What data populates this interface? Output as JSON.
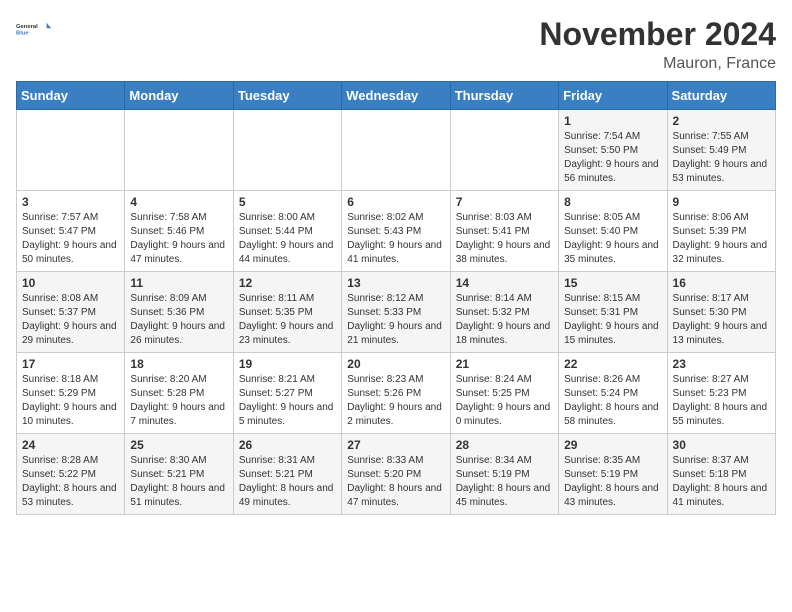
{
  "header": {
    "logo_general": "General",
    "logo_blue": "Blue",
    "title": "November 2024",
    "location": "Mauron, France"
  },
  "calendar": {
    "weekdays": [
      "Sunday",
      "Monday",
      "Tuesday",
      "Wednesday",
      "Thursday",
      "Friday",
      "Saturday"
    ],
    "weeks": [
      [
        {
          "day": "",
          "detail": ""
        },
        {
          "day": "",
          "detail": ""
        },
        {
          "day": "",
          "detail": ""
        },
        {
          "day": "",
          "detail": ""
        },
        {
          "day": "",
          "detail": ""
        },
        {
          "day": "1",
          "detail": "Sunrise: 7:54 AM\nSunset: 5:50 PM\nDaylight: 9 hours and 56 minutes."
        },
        {
          "day": "2",
          "detail": "Sunrise: 7:55 AM\nSunset: 5:49 PM\nDaylight: 9 hours and 53 minutes."
        }
      ],
      [
        {
          "day": "3",
          "detail": "Sunrise: 7:57 AM\nSunset: 5:47 PM\nDaylight: 9 hours and 50 minutes."
        },
        {
          "day": "4",
          "detail": "Sunrise: 7:58 AM\nSunset: 5:46 PM\nDaylight: 9 hours and 47 minutes."
        },
        {
          "day": "5",
          "detail": "Sunrise: 8:00 AM\nSunset: 5:44 PM\nDaylight: 9 hours and 44 minutes."
        },
        {
          "day": "6",
          "detail": "Sunrise: 8:02 AM\nSunset: 5:43 PM\nDaylight: 9 hours and 41 minutes."
        },
        {
          "day": "7",
          "detail": "Sunrise: 8:03 AM\nSunset: 5:41 PM\nDaylight: 9 hours and 38 minutes."
        },
        {
          "day": "8",
          "detail": "Sunrise: 8:05 AM\nSunset: 5:40 PM\nDaylight: 9 hours and 35 minutes."
        },
        {
          "day": "9",
          "detail": "Sunrise: 8:06 AM\nSunset: 5:39 PM\nDaylight: 9 hours and 32 minutes."
        }
      ],
      [
        {
          "day": "10",
          "detail": "Sunrise: 8:08 AM\nSunset: 5:37 PM\nDaylight: 9 hours and 29 minutes."
        },
        {
          "day": "11",
          "detail": "Sunrise: 8:09 AM\nSunset: 5:36 PM\nDaylight: 9 hours and 26 minutes."
        },
        {
          "day": "12",
          "detail": "Sunrise: 8:11 AM\nSunset: 5:35 PM\nDaylight: 9 hours and 23 minutes."
        },
        {
          "day": "13",
          "detail": "Sunrise: 8:12 AM\nSunset: 5:33 PM\nDaylight: 9 hours and 21 minutes."
        },
        {
          "day": "14",
          "detail": "Sunrise: 8:14 AM\nSunset: 5:32 PM\nDaylight: 9 hours and 18 minutes."
        },
        {
          "day": "15",
          "detail": "Sunrise: 8:15 AM\nSunset: 5:31 PM\nDaylight: 9 hours and 15 minutes."
        },
        {
          "day": "16",
          "detail": "Sunrise: 8:17 AM\nSunset: 5:30 PM\nDaylight: 9 hours and 13 minutes."
        }
      ],
      [
        {
          "day": "17",
          "detail": "Sunrise: 8:18 AM\nSunset: 5:29 PM\nDaylight: 9 hours and 10 minutes."
        },
        {
          "day": "18",
          "detail": "Sunrise: 8:20 AM\nSunset: 5:28 PM\nDaylight: 9 hours and 7 minutes."
        },
        {
          "day": "19",
          "detail": "Sunrise: 8:21 AM\nSunset: 5:27 PM\nDaylight: 9 hours and 5 minutes."
        },
        {
          "day": "20",
          "detail": "Sunrise: 8:23 AM\nSunset: 5:26 PM\nDaylight: 9 hours and 2 minutes."
        },
        {
          "day": "21",
          "detail": "Sunrise: 8:24 AM\nSunset: 5:25 PM\nDaylight: 9 hours and 0 minutes."
        },
        {
          "day": "22",
          "detail": "Sunrise: 8:26 AM\nSunset: 5:24 PM\nDaylight: 8 hours and 58 minutes."
        },
        {
          "day": "23",
          "detail": "Sunrise: 8:27 AM\nSunset: 5:23 PM\nDaylight: 8 hours and 55 minutes."
        }
      ],
      [
        {
          "day": "24",
          "detail": "Sunrise: 8:28 AM\nSunset: 5:22 PM\nDaylight: 8 hours and 53 minutes."
        },
        {
          "day": "25",
          "detail": "Sunrise: 8:30 AM\nSunset: 5:21 PM\nDaylight: 8 hours and 51 minutes."
        },
        {
          "day": "26",
          "detail": "Sunrise: 8:31 AM\nSunset: 5:21 PM\nDaylight: 8 hours and 49 minutes."
        },
        {
          "day": "27",
          "detail": "Sunrise: 8:33 AM\nSunset: 5:20 PM\nDaylight: 8 hours and 47 minutes."
        },
        {
          "day": "28",
          "detail": "Sunrise: 8:34 AM\nSunset: 5:19 PM\nDaylight: 8 hours and 45 minutes."
        },
        {
          "day": "29",
          "detail": "Sunrise: 8:35 AM\nSunset: 5:19 PM\nDaylight: 8 hours and 43 minutes."
        },
        {
          "day": "30",
          "detail": "Sunrise: 8:37 AM\nSunset: 5:18 PM\nDaylight: 8 hours and 41 minutes."
        }
      ]
    ]
  }
}
